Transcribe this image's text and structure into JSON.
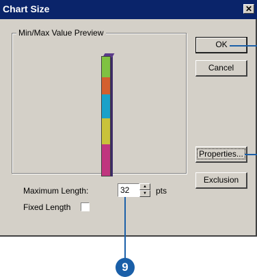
{
  "window": {
    "title": "Chart Size",
    "close_glyph": "✕"
  },
  "preview_group": {
    "label": "Min/Max Value Preview",
    "bar_segments": [
      {
        "color": "#7fc241",
        "name": "green"
      },
      {
        "color": "#d35f2f",
        "name": "orange"
      },
      {
        "color": "#1aa1c9",
        "name": "cyan"
      },
      {
        "color": "#c9c23a",
        "name": "yellow"
      },
      {
        "color": "#c0357f",
        "name": "magenta"
      }
    ]
  },
  "buttons": {
    "ok": "OK",
    "cancel": "Cancel",
    "properties": "Properties...",
    "exclusion": "Exclusion"
  },
  "settings": {
    "max_length_label": "Maximum Length:",
    "max_length_value": "32",
    "units": "pts",
    "fixed_length_label": "Fixed Length",
    "fixed_length_checked": false
  },
  "callout": {
    "number": "9",
    "color": "#1a5fa8"
  }
}
